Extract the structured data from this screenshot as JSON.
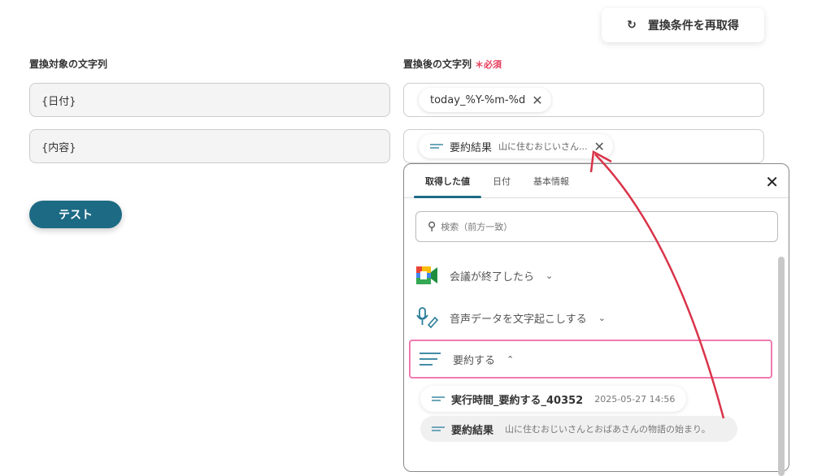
{
  "header": {
    "refetch_label": "置換条件を再取得"
  },
  "left": {
    "label": "置換対象の文字列",
    "fields": [
      "{日付}",
      "{内容}"
    ]
  },
  "right": {
    "label": "置換後の文字列",
    "required": "必須",
    "chip1": {
      "label": "today_%Y-%m-%d"
    },
    "chip2": {
      "label": "要約結果",
      "preview": "山に住むおじいさん..."
    }
  },
  "test_button": "テスト",
  "panel": {
    "tabs": [
      "取得した値",
      "日付",
      "基本情報"
    ],
    "search_placeholder": "検索（前方一致）",
    "groups": [
      "会議が終了したら",
      "音声データを文字起こしする",
      "要約する"
    ],
    "items": [
      {
        "label": "実行時間_要約する_40352",
        "value": "2025-05-27 14:56"
      },
      {
        "label": "要約結果",
        "value": "山に住むおじいさんとおばあさんの物語の始まり。"
      }
    ]
  },
  "colors": {
    "accent": "#1d6a84",
    "highlight": "#ef7bb0",
    "arrow": "#d9344a"
  }
}
